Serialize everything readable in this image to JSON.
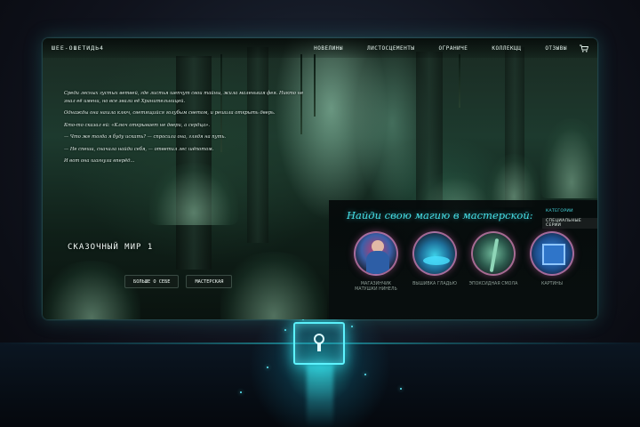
{
  "nav": {
    "logo": "ШЕЕ-ОШЕТИДЬ4",
    "items": [
      "Новелины",
      "Листосцементы",
      "Ограниче",
      "Коллекцц",
      "Отзывы"
    ],
    "cart_icon": "cart-icon"
  },
  "hero": {
    "paragraphs": [
      "Среди лесных густых ветвей, где листья шепчут свои тайны, жила маленькая фея. Никто не знал её имени, но все звали её Хранительницей.",
      "Однажды она нашла ключ, светящийся голубым светом, и решила открыть дверь.",
      "Кто-то сказал ей: «Ключ открывает не двери, а сердца».",
      "— Что же тогда я буду искать? — спросила она, глядя на путь.",
      "— Не спеши, сначала найди себя, — ответил лес шёпотом.",
      "И вот она шагнула вперёд…"
    ],
    "headline": "Сказочный мир 1",
    "buttons": [
      "Больше о себе",
      "Мастерская"
    ]
  },
  "workshop": {
    "title": "Найди свою магию в мастерской:",
    "categories": [
      "Категории",
      "Специальные серии"
    ],
    "cards": [
      {
        "label_line1": "Магазинчик",
        "label_line2": "матушки Нинель",
        "color": "#c23b6f"
      },
      {
        "label_line1": "Вышивка гладью",
        "label_line2": "",
        "color": "#2f8fb0"
      },
      {
        "label_line1": "Эпоксидная смола",
        "label_line2": "",
        "color": "#4a8b7a"
      },
      {
        "label_line1": "Картины",
        "label_line2": "",
        "color": "#2e6fb5"
      }
    ],
    "next_icon": "chevron-right-icon"
  },
  "colors": {
    "accent": "#46e0e8",
    "card_border": "#c878aa"
  },
  "decor": {
    "lock_icon": "keyhole-icon"
  }
}
